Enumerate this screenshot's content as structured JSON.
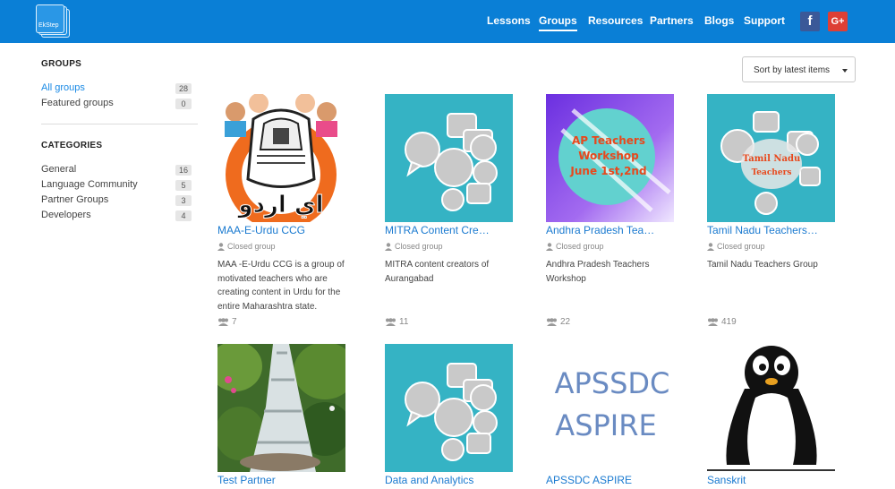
{
  "header": {
    "logo_text": "EkStep",
    "nav": [
      {
        "label": "Lessons",
        "active": false
      },
      {
        "label": "Groups",
        "active": true
      },
      {
        "label": "Resources",
        "active": false
      },
      {
        "label": "Partners",
        "active": false
      },
      {
        "label": "Blogs",
        "active": false
      },
      {
        "label": "Support",
        "active": false
      }
    ],
    "facebook_glyph": "f",
    "googleplus_glyph": "G+",
    "bar_color": "#0a7fd6"
  },
  "sidebar": {
    "groups_heading": "GROUPS",
    "groups": [
      {
        "label": "All groups",
        "count": "28",
        "active": true
      },
      {
        "label": "Featured groups",
        "count": "0",
        "active": false
      }
    ],
    "categories_heading": "CATEGORIES",
    "categories": [
      {
        "label": "General",
        "count": "16"
      },
      {
        "label": "Language Community",
        "count": "5"
      },
      {
        "label": "Partner Groups",
        "count": "3"
      },
      {
        "label": "Developers",
        "count": "4"
      }
    ]
  },
  "sort": {
    "label": "Sort by latest items"
  },
  "cards": [
    {
      "title": "MAA-E-Urdu CCG",
      "status": "Closed group",
      "description": "MAA -E-Urdu CCG is a group of motivated teachers who are creating content in Urdu for the entire Maharashtra state.",
      "members": "7",
      "thumb": "urdu-logo",
      "thumb_text": "اي اردو"
    },
    {
      "title": "MITRA Content Cre…",
      "status": "Closed group",
      "description": "MITRA content creators of Aurangabad",
      "members": "11",
      "thumb": "chat-bubbles"
    },
    {
      "title": "Andhra Pradesh Tea…",
      "status": "Closed group",
      "description": "Andhra Pradesh Teachers Workshop",
      "members": "22",
      "thumb": "ap-workshop",
      "thumb_lines": [
        "AP Teachers",
        "Workshop",
        "June 1st,2nd"
      ]
    },
    {
      "title": "Tamil Nadu Teachers…",
      "status": "Closed group",
      "description": "Tamil Nadu Teachers Group",
      "members": "419",
      "thumb": "tamil-bubbles",
      "thumb_lines": [
        "Tamil Nadu",
        "Teachers"
      ]
    },
    {
      "title": "Test Partner",
      "thumb": "waterfall"
    },
    {
      "title": "Data and Analytics",
      "thumb": "chat-bubbles"
    },
    {
      "title": "APSSDC ASPIRE",
      "thumb": "apssdc-text",
      "thumb_lines": [
        "APSSDC",
        "ASPIRE"
      ]
    },
    {
      "title": "Sanskrit",
      "thumb": "penguin"
    }
  ],
  "colors": {
    "accent": "#1a8ae5",
    "tile_teal": "#35b3c4"
  }
}
